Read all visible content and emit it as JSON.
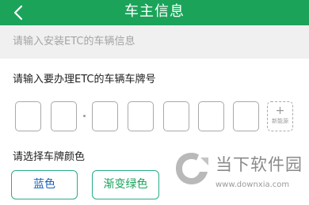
{
  "header": {
    "title": "车主信息",
    "back_icon": "chevron-left-icon"
  },
  "subheader": {
    "text": "请输入安装ETC的车辆信息"
  },
  "plate": {
    "label": "请输入要办理ETC的车辆车牌号",
    "new_energy_plus": "+",
    "new_energy_label": "新能源"
  },
  "plate_color": {
    "label": "请选择车牌颜色",
    "options": [
      "蓝色",
      "渐变绿色"
    ]
  },
  "watermark": {
    "name": "当下软件园",
    "url": "www.downxia.com"
  },
  "colors": {
    "header_bg": "#1ba35a",
    "button_border": "#29ad86",
    "blue_text": "#1a5fb8",
    "green_text": "#18a35a"
  }
}
